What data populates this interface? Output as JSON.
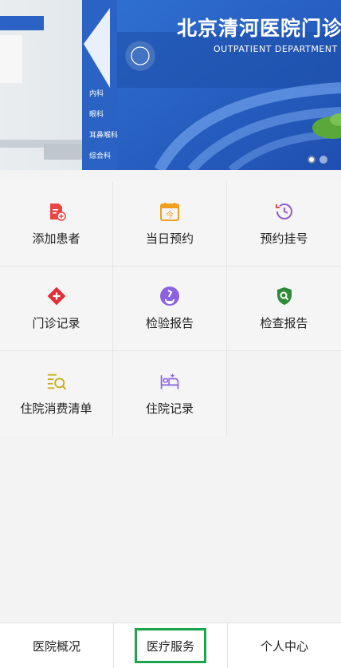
{
  "banner": {
    "title": "北京清河医院门诊",
    "subtitle": "OUTPATIENT DEPARTMENT",
    "departments": [
      "内科",
      "眼科",
      "耳鼻喉科",
      "综合科"
    ],
    "carousel_active_index": 0,
    "carousel_count": 2
  },
  "services": [
    {
      "label": "添加患者",
      "icon": "add-patient-icon",
      "color": "#e94545"
    },
    {
      "label": "当日预约",
      "icon": "calendar-today-icon",
      "color": "#f0a01e"
    },
    {
      "label": "预约挂号",
      "icon": "clock-history-icon",
      "color": "#8f5bd6"
    },
    {
      "label": "门诊记录",
      "icon": "medical-cross-icon",
      "color": "#e02e3a"
    },
    {
      "label": "检验报告",
      "icon": "microscope-icon",
      "color": "#8b63e0"
    },
    {
      "label": "检查报告",
      "icon": "shield-search-icon",
      "color": "#2f8a3a"
    },
    {
      "label": "住院消费清单",
      "icon": "list-search-icon",
      "color": "#c9b120"
    },
    {
      "label": "住院记录",
      "icon": "hospital-bed-icon",
      "color": "#8b63e0"
    }
  ],
  "nav": {
    "items": [
      "医院概况",
      "医疗服务",
      "个人中心"
    ],
    "selected": "医疗服务",
    "selected_color": "#1ea54b"
  }
}
